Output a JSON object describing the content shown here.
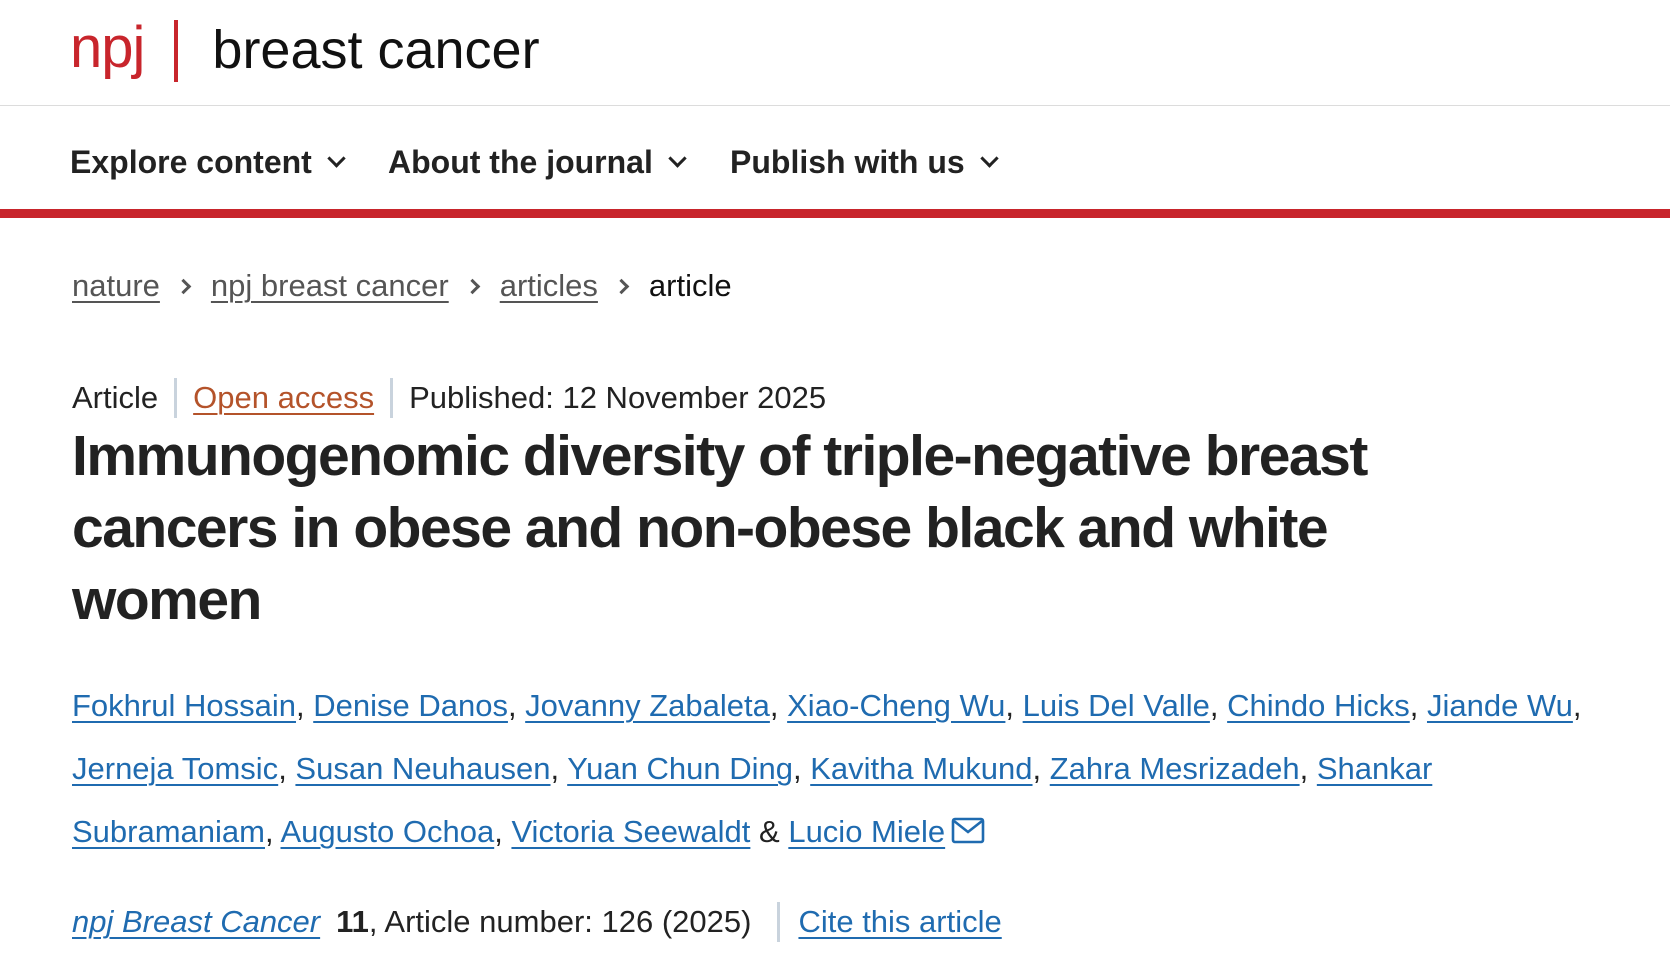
{
  "header": {
    "logo_prefix": "npj",
    "logo_title": "breast cancer"
  },
  "nav": [
    {
      "label": "Explore content"
    },
    {
      "label": "About the journal"
    },
    {
      "label": "Publish with us"
    }
  ],
  "breadcrumb": {
    "items": [
      "nature",
      "npj breast cancer",
      "articles"
    ],
    "current": "article"
  },
  "article": {
    "type": "Article",
    "access": "Open access",
    "published": "Published: 12 November 2025",
    "title": "Immunogenomic diversity of triple-negative breast cancers in obese and non-obese black and white women",
    "authors": [
      "Fokhrul Hossain",
      "Denise Danos",
      "Jovanny Zabaleta",
      "Xiao-Cheng Wu",
      "Luis Del Valle",
      "Chindo Hicks",
      "Jiande Wu",
      "Jerneja Tomsic",
      "Susan Neuhausen",
      "Yuan Chun Ding",
      "Kavitha Mukund",
      "Zahra Mesrizadeh",
      "Shankar Subramaniam",
      "Augusto Ochoa",
      "Victoria Seewaldt",
      "Lucio Miele"
    ],
    "ampersand": "&",
    "separator": ", ",
    "mail_icon": "mail-icon"
  },
  "citation": {
    "journal": "npj Breast Cancer",
    "volume": "11",
    "article_number": ", Article number: 126 (2025)",
    "cite_label": "Cite this article"
  },
  "colors": {
    "brand_red": "#c8252c",
    "link_blue": "#1f6bb0",
    "open_access": "#b4532a"
  }
}
